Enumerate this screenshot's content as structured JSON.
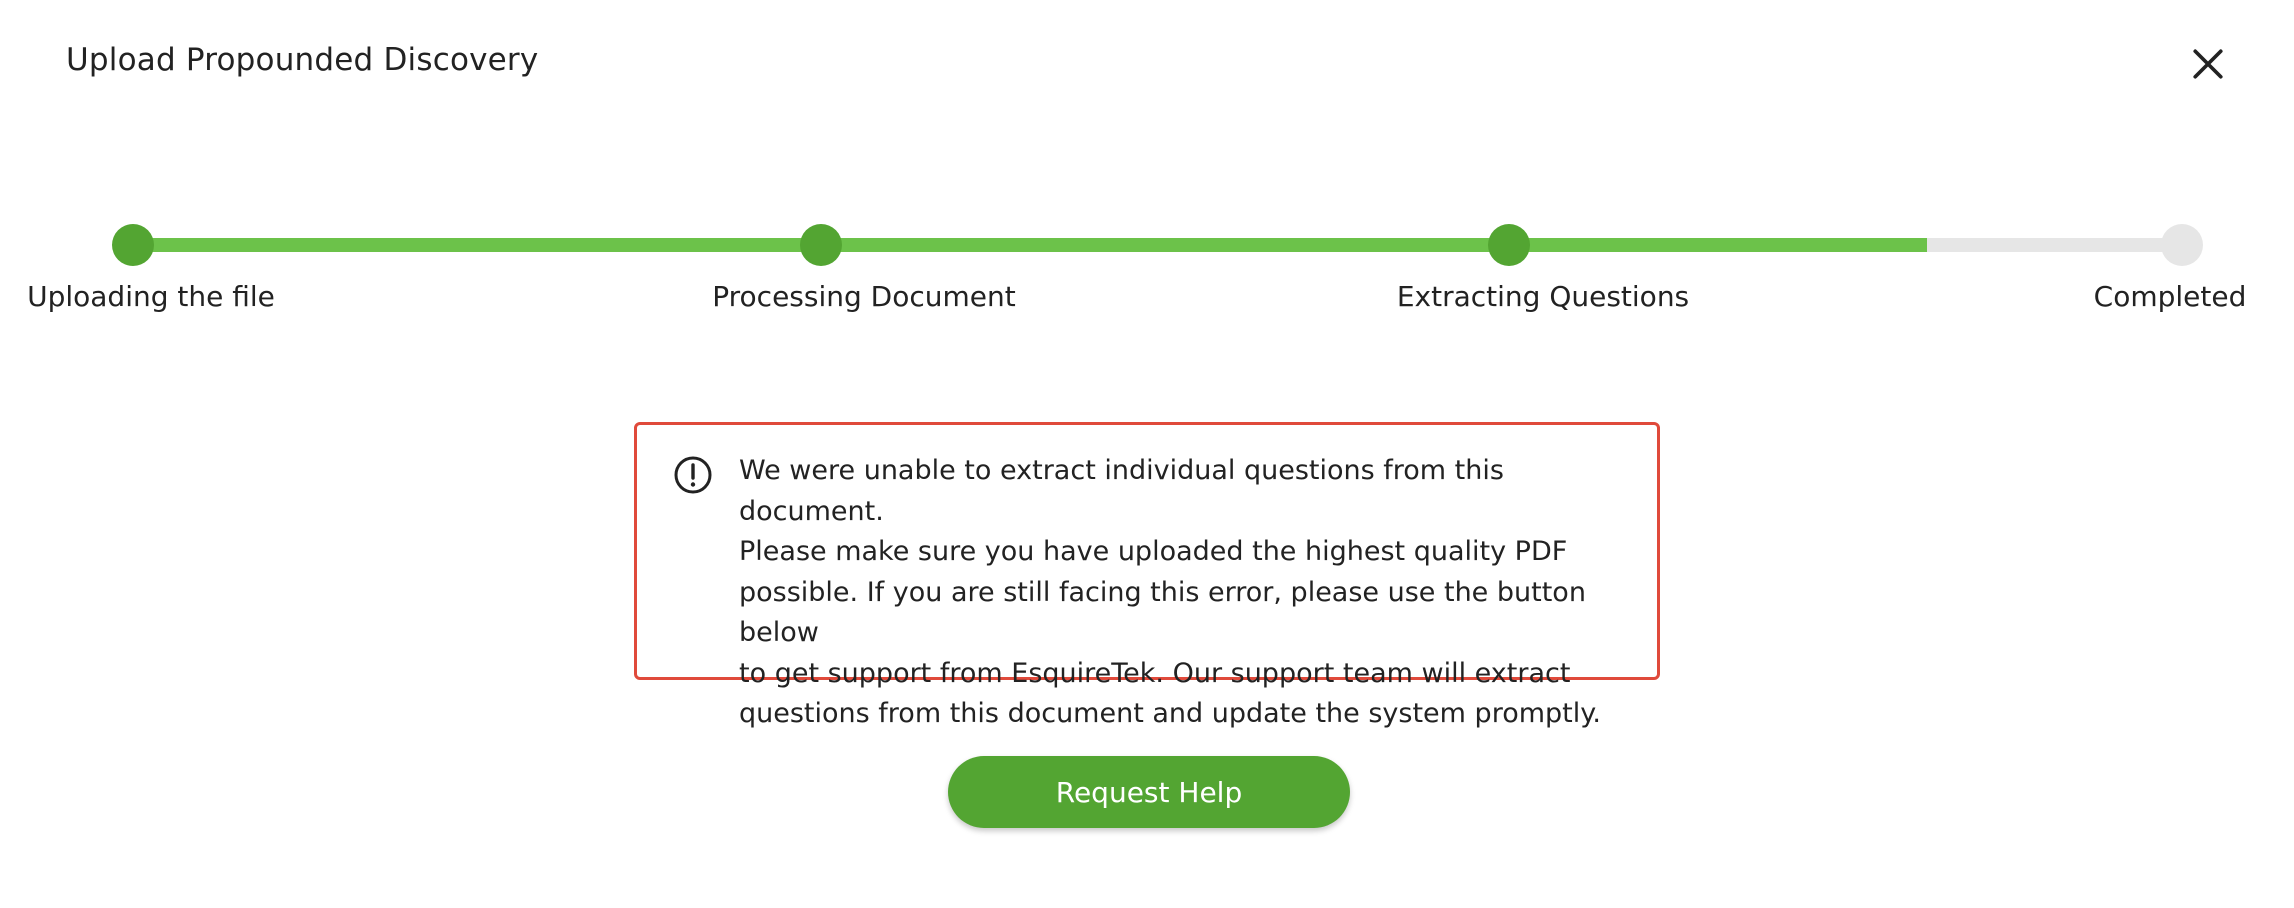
{
  "modal": {
    "title": "Upload Propounded Discovery",
    "close_icon": "close-icon"
  },
  "stepper": {
    "progress_percent": 88,
    "steps": [
      {
        "label": "Uploading the file",
        "state": "complete"
      },
      {
        "label": "Processing Document",
        "state": "complete"
      },
      {
        "label": "Extracting Questions",
        "state": "complete"
      },
      {
        "label": "Completed",
        "state": "pending"
      }
    ]
  },
  "error": {
    "icon": "alert-circle-icon",
    "lines": [
      "We were unable to extract individual questions from this document.",
      "Please make sure you have uploaded the highest quality PDF",
      "possible. If you are still facing this error, please use the button below",
      "to get support from EsquireTek. Our support team will extract",
      "questions from this document and update the system promptly."
    ]
  },
  "actions": {
    "request_help_label": "Request Help"
  },
  "colors": {
    "accent": "#53a532",
    "track_fill": "#6cc24a",
    "track_empty": "#e6e6e6",
    "error_border": "#e04a3b"
  }
}
